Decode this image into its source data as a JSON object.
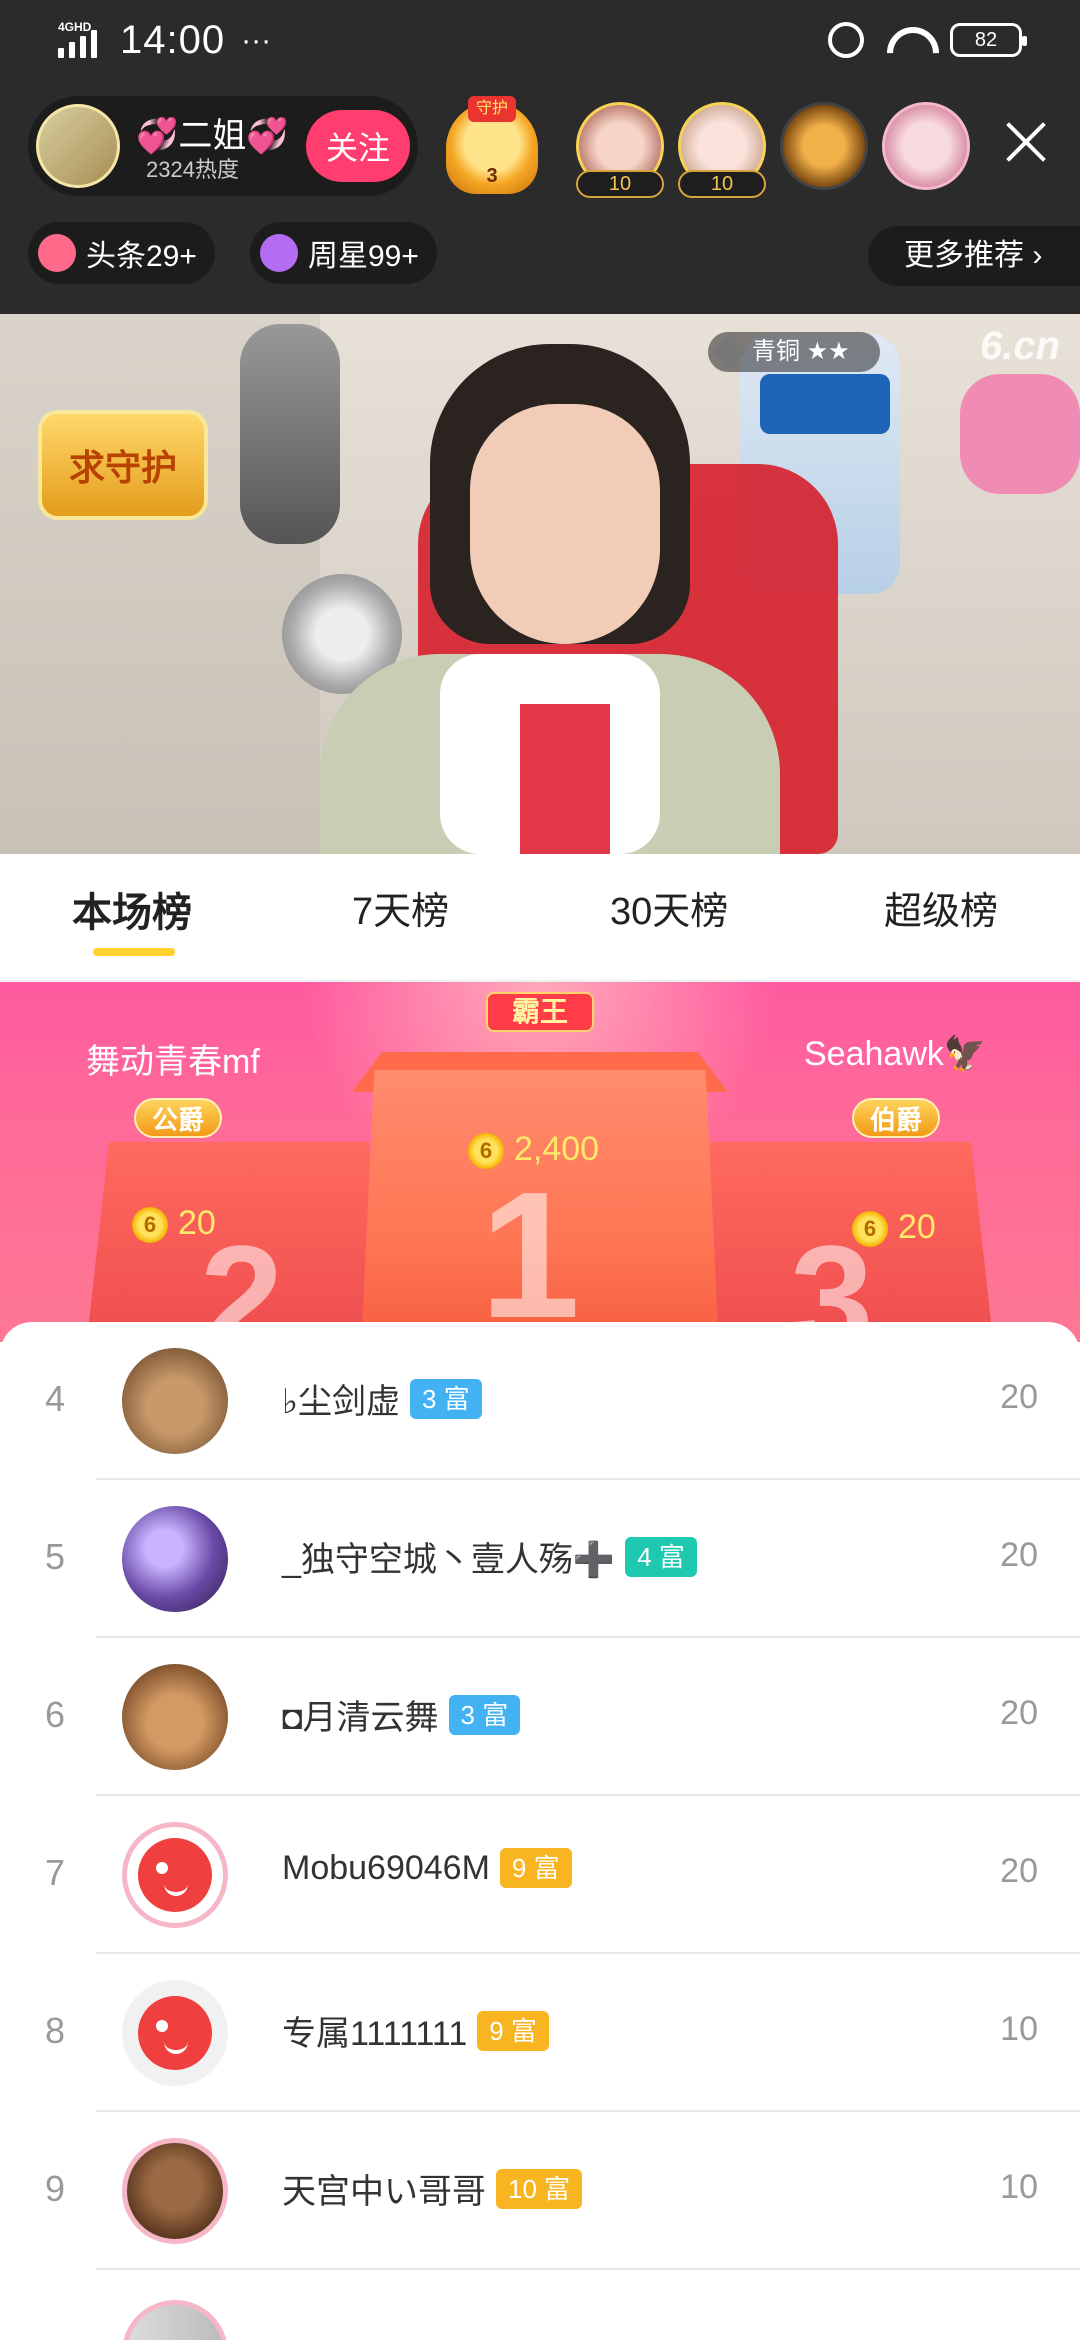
{
  "status_bar": {
    "network": "4GHD",
    "time": "14:00",
    "more": "···",
    "battery": "82"
  },
  "host": {
    "name": "💞二姐💞",
    "heat": "2324热度",
    "follow_label": "关注"
  },
  "guard": {
    "tag": "守护",
    "count": "3"
  },
  "viewers": [
    {
      "badge": "10"
    },
    {
      "badge": "10"
    },
    {
      "badge": ""
    },
    {
      "badge": ""
    }
  ],
  "chips": {
    "headline": "头条29+",
    "weekly_star": "周星99+",
    "more_recommend": "更多推荐 ›"
  },
  "video": {
    "shield_text": "求守护",
    "rank_tag": "青铜 ★★",
    "watermark": "6.cn"
  },
  "tabs": [
    "本场榜",
    "7天榜",
    "30天榜",
    "超级榜"
  ],
  "podium": {
    "king_label": "霸王",
    "first": {
      "rank": "1",
      "score": "2,400"
    },
    "second": {
      "rank": "2",
      "name": "舞动青春mf",
      "title": "公爵",
      "score": "20"
    },
    "third": {
      "rank": "3",
      "name": "Seahawk🦅",
      "title": "伯爵",
      "score": "20"
    }
  },
  "ranking": [
    {
      "rank": "4",
      "name": "♭尘剑虚",
      "level": "3 富",
      "level_color": "#42b2f2",
      "points": "20"
    },
    {
      "rank": "5",
      "name": "_独守空城丶壹人殇➕",
      "level": "4 富",
      "level_color": "#1ec9b0",
      "points": "20"
    },
    {
      "rank": "6",
      "name": "◘月清云舞",
      "level": "3 富",
      "level_color": "#42b2f2",
      "points": "20"
    },
    {
      "rank": "7",
      "name": "Mobu69046M",
      "level": "9 富",
      "level_color": "#f8b421",
      "points": "20"
    },
    {
      "rank": "8",
      "name": "专属1111111",
      "level": "9 富",
      "level_color": "#f8b421",
      "points": "10"
    },
    {
      "rank": "9",
      "name": "天宫中い哥哥",
      "level": "10 富",
      "level_color": "#f8b421",
      "points": "10"
    }
  ]
}
